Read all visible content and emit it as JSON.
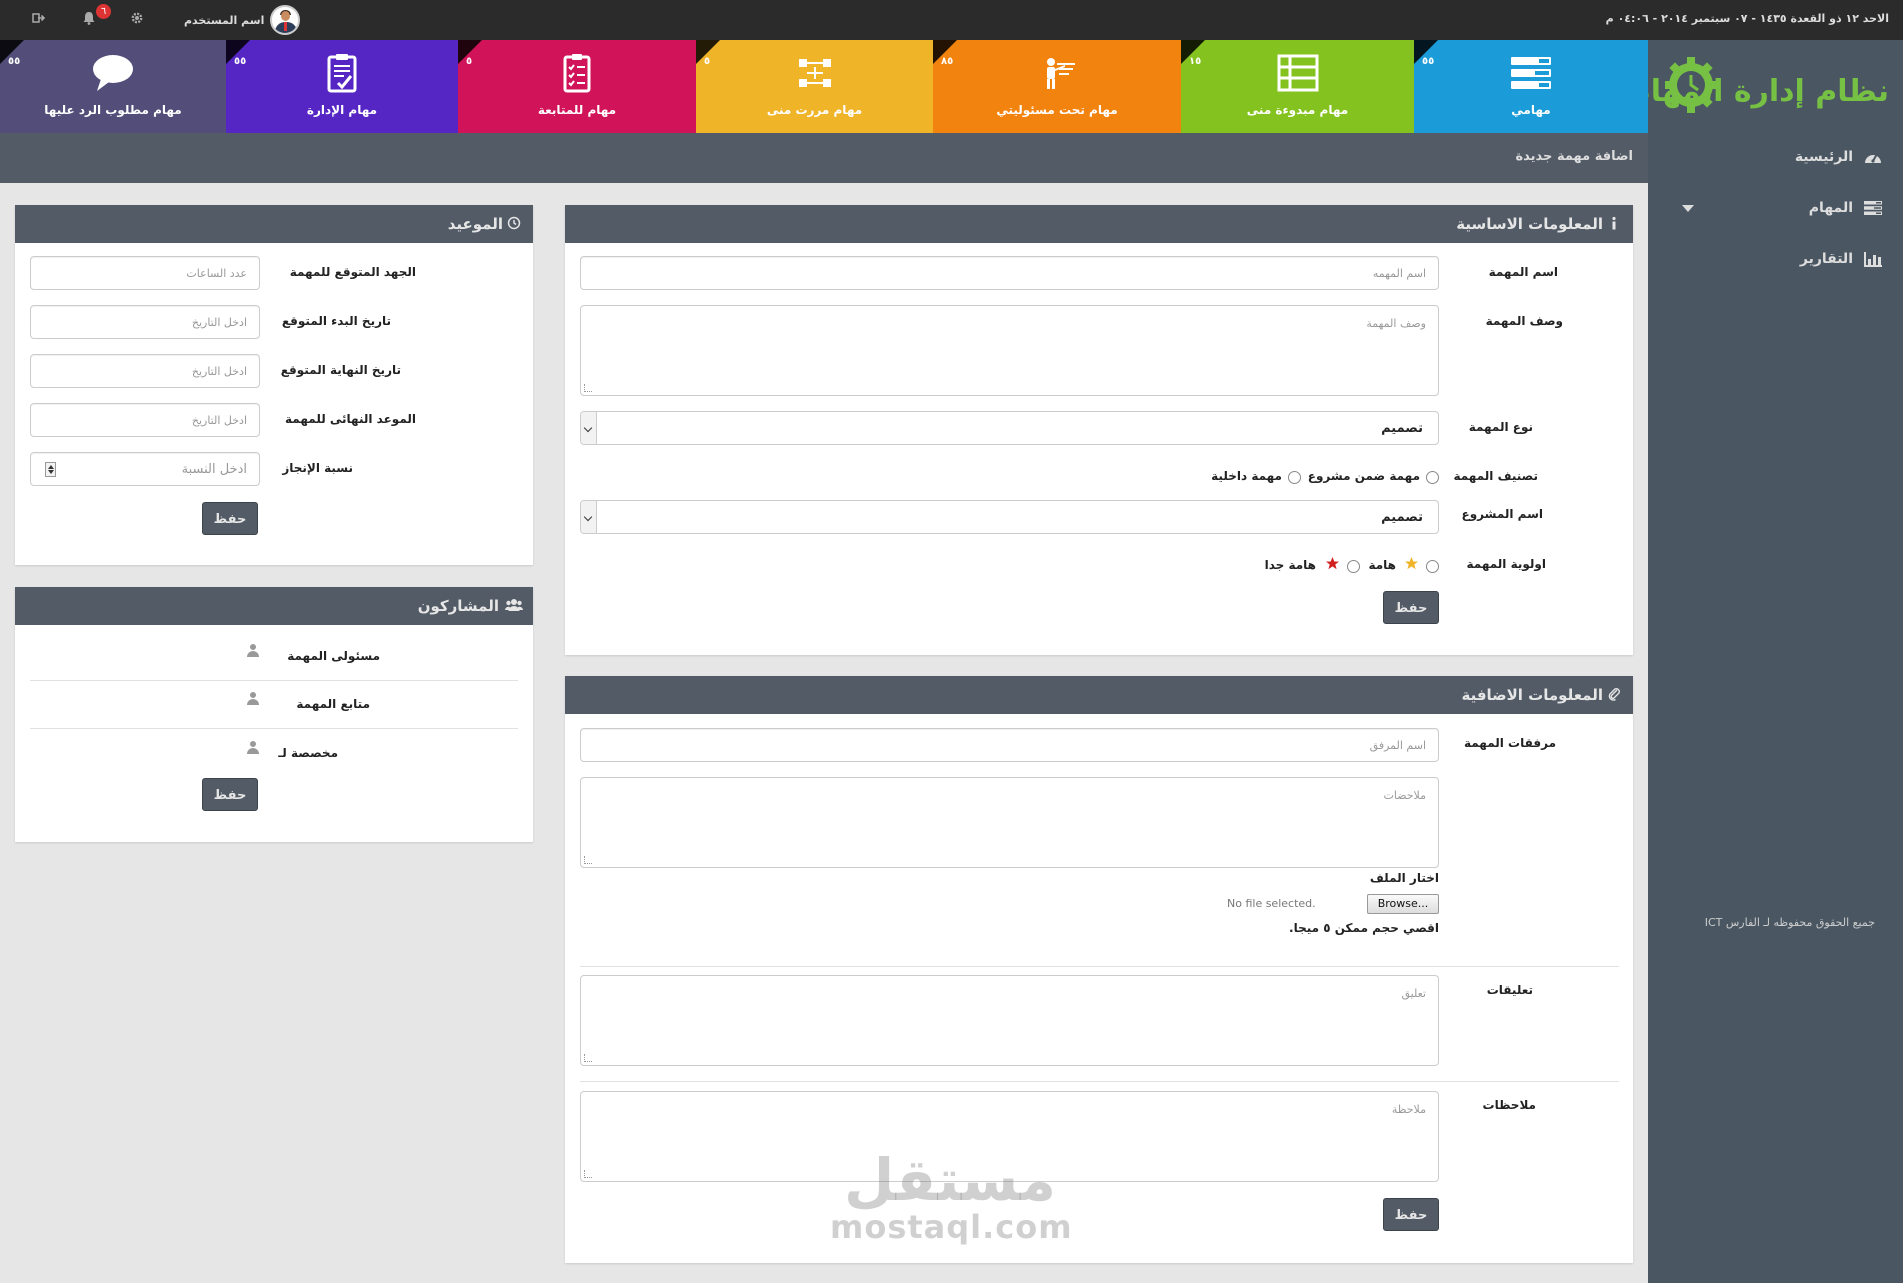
{
  "topbar": {
    "date": "الاحد ١٢ ذو القعدة ١٤٣٥ - ٠٧ سبتمبر ٢٠١٤ - ٠٤:٠٦ م",
    "username": "اسم المستخدم",
    "notifications_count": "٦"
  },
  "logo": {
    "title": "نظام إدارة المهام"
  },
  "tiles": [
    {
      "label": "مهامي",
      "count": "٥٥",
      "color": "#1b9bd8",
      "icon": "list-icon"
    },
    {
      "label": "مهام مبدوءة منى",
      "count": "١٥",
      "color": "#84c31f",
      "icon": "table-icon"
    },
    {
      "label": "مهام تحت مسئوليتي",
      "count": "٨٥",
      "color": "#f2830f",
      "icon": "presenter-icon"
    },
    {
      "label": "مهام مررت منى",
      "count": "٥",
      "color": "#f0b429",
      "icon": "flow-icon"
    },
    {
      "label": "مهام للمتابعة",
      "count": "٥",
      "color": "#d1145a",
      "icon": "checklist-icon"
    },
    {
      "label": "مهام الإدارة",
      "count": "٥٥",
      "color": "#5526c4",
      "icon": "clipboard-icon"
    },
    {
      "label": "مهام مطلوب الرد عليها",
      "count": "٥٥",
      "color": "#524d79",
      "icon": "speech-bubble-icon"
    }
  ],
  "sidebar": {
    "items": [
      {
        "label": "الرئيسية",
        "icon": "dashboard-icon"
      },
      {
        "label": "المهام",
        "icon": "tasks-icon"
      },
      {
        "label": "التقارير",
        "icon": "bar-chart-icon"
      }
    ],
    "copyright": "جميع الحقوق محفوظه لـ الفارس ICT"
  },
  "page": {
    "title": "اضافة مهمة جديدة"
  },
  "basic_info": {
    "title": "المعلومات الاساسية",
    "task_name_label": "اسم المهمة",
    "task_name_placeholder": "اسم المهمه",
    "desc_label": "وصف المهمة",
    "desc_placeholder": "وصف المهمة",
    "type_label": "نوع المهمة",
    "type_value": "تصميم",
    "class_label": "تصنيف المهمة",
    "class_option1": "مهمة ضمن مشروع",
    "class_option2": "مهمة داخلية",
    "project_label": "اسم المشروع",
    "project_value": "تصميم",
    "priority_label": "اولوية المهمة",
    "priority_option1": "هامة",
    "priority_option2": "هامة جدا",
    "save": "حفظ"
  },
  "extra_info": {
    "title": "المعلومات الاضافية",
    "attachments_label": "مرفقات المهمة",
    "attachment_placeholder": "اسم المرفق",
    "notes_placeholder": "ملاحضات",
    "choose_file_label": "اختار الملف",
    "browse_label": "Browse...",
    "file_status": "No file selected.",
    "max_size": "اقصي حجم ممكن ٥ ميجا.",
    "comments_label": "تعليقات",
    "comment_placeholder": "تعليق",
    "remarks_label": "ملاحظات",
    "remark_placeholder": "ملاحظة",
    "save": "حفظ"
  },
  "schedule": {
    "title": "الموعيد",
    "effort_label": "الجهد المتوقع للمهمة",
    "effort_placeholder": "عدد الساعات",
    "start_label": "تاريخ البدء المتوقع",
    "start_placeholder": "ادخل التاريخ",
    "end_label": "تاريخ النهاية المتوقع",
    "end_placeholder": "ادخل التاريخ",
    "deadline_label": "الموعد النهائى للمهمة",
    "deadline_placeholder": "ادخل التاريخ",
    "progress_label": "نسبة الإنجاز",
    "progress_placeholder": "ادخل النسبة",
    "save": "حفظ"
  },
  "participants": {
    "title": "المشاركون",
    "rows": [
      "مسئولى المهمة",
      "متابع المهمة",
      "مخصصة لـ"
    ],
    "save": "حفظ"
  },
  "watermark": {
    "arabic": "مستقل",
    "latin": "mostaql.com"
  }
}
